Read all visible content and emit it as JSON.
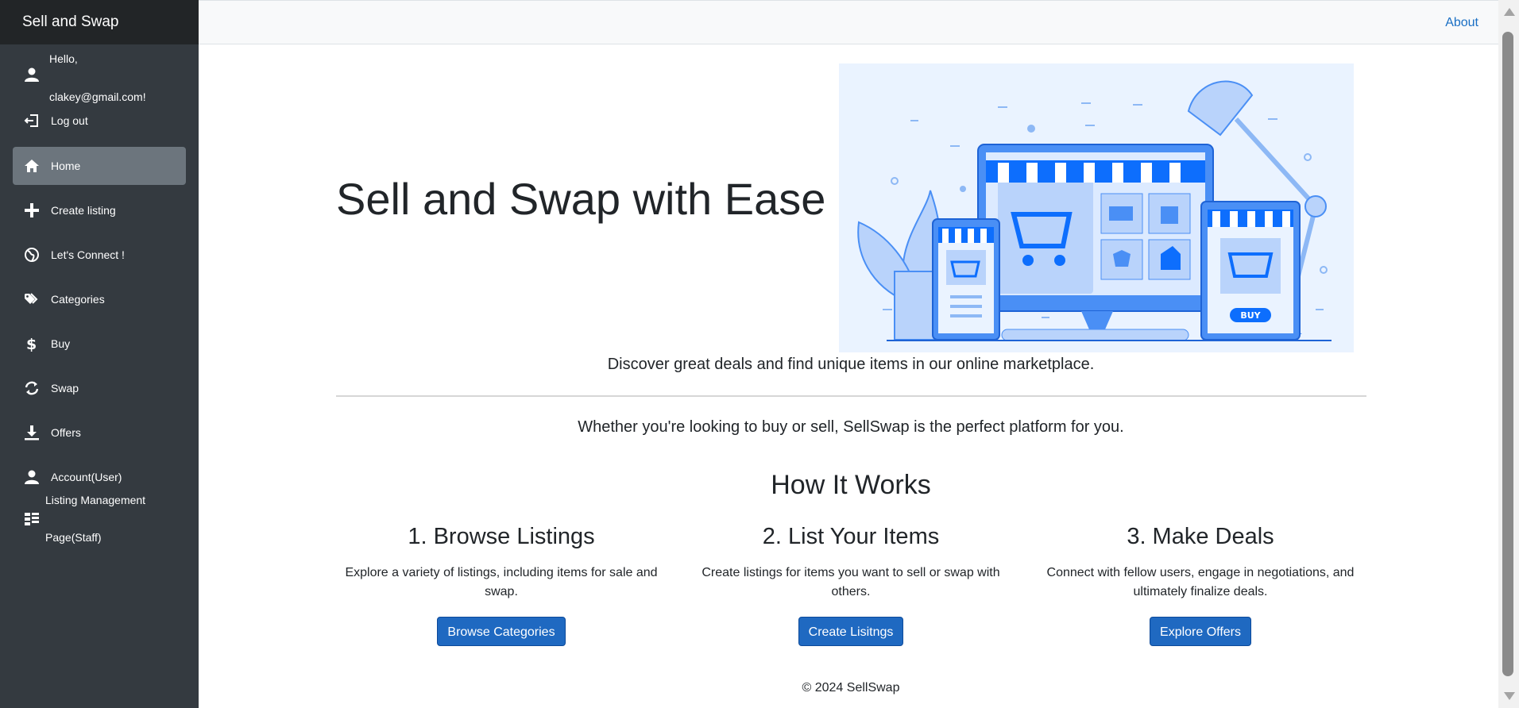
{
  "brand": "Sell and Swap",
  "user": {
    "hello": "Hello,",
    "email": "clakey@gmail.com!"
  },
  "logout_label": "Log out",
  "nav": {
    "home": "Home",
    "create_listing": "Create listing",
    "connect": "Let's Connect !",
    "categories": "Categories",
    "buy": "Buy",
    "swap": "Swap",
    "offers": "Offers",
    "account": "Account(User)",
    "listing_mgmt_line1": "Listing Management",
    "listing_mgmt_line2": "Page(Staff)"
  },
  "topbar": {
    "about": "About"
  },
  "hero": {
    "title": "Sell and Swap with Ease",
    "tagline": "Discover great deals and find unique items in our online marketplace.",
    "subtitle": "Whether you're looking to buy or sell, SellSwap is the perfect platform for you.",
    "image_buy_label": "BUY"
  },
  "how": {
    "title": "How It Works",
    "steps": [
      {
        "title": "1. Browse Listings",
        "text": "Explore a variety of listings, including items for sale and swap.",
        "button": "Browse Categories"
      },
      {
        "title": "2. List Your Items",
        "text": "Create listings for items you want to sell or swap with others.",
        "button": "Create Lisitngs"
      },
      {
        "title": "3. Make Deals",
        "text": "Connect with fellow users, engage in negotiations, and ultimately finalize deals.",
        "button": "Explore Offers"
      }
    ]
  },
  "footer": "© 2024 SellSwap",
  "colors": {
    "sidebar": "#343a40",
    "brand_bar": "#222527",
    "active_nav": "#6c757d",
    "primary_button": "#1f69c1",
    "link": "#1a6fc4",
    "illustration_bg": "#eaf3ff",
    "illustration_blue": "#0d6efd"
  }
}
